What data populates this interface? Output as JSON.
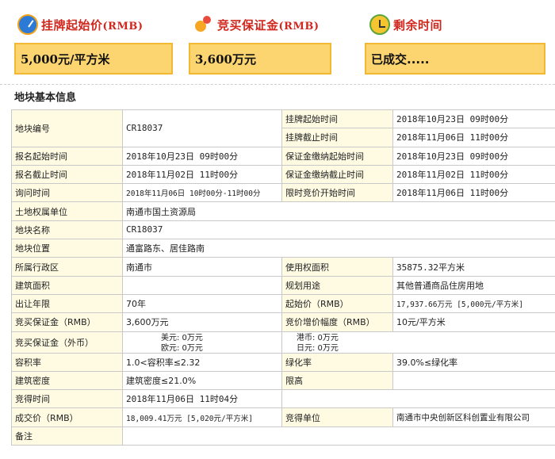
{
  "header": {
    "start_price_label": "挂牌起始价",
    "start_price_unit": "(RMB)",
    "deposit_label": "竞买保证金",
    "deposit_unit": "(RMB)",
    "remaining_label": "剩余时间",
    "start_price_value": "5,000元/平方米",
    "deposit_value": "3,600万元",
    "remaining_value": "已成交....."
  },
  "section_title": "地块基本信息",
  "icons": {
    "start_price": "gauge-icon",
    "deposit": "coins-hand-icon",
    "remaining": "alarm-clock-icon"
  },
  "table": {
    "r1": {
      "l1": "地块编号",
      "v1": "CR18037",
      "l2a": "挂牌起始时间",
      "v2a": "2018年10月23日 09时00分",
      "l2b": "挂牌截止时间",
      "v2b": "2018年11月06日 11时00分"
    },
    "r2": {
      "l1": "报名起始时间",
      "v1": "2018年10月23日 09时00分",
      "l2": "保证金缴纳起始时间",
      "v2": "2018年10月23日 09时00分"
    },
    "r3": {
      "l1": "报名截止时间",
      "v1": "2018年11月02日 11时00分",
      "l2": "保证金缴纳截止时间",
      "v2": "2018年11月02日 11时00分"
    },
    "r4": {
      "l1": "询问时间",
      "v1": "2018年11月06日 10时00分-11时00分",
      "l2": "限时竞价开始时间",
      "v2": "2018年11月06日 11时00分"
    },
    "r5": {
      "l1": "土地权属单位",
      "v1": "南通市国土资源局"
    },
    "r6": {
      "l1": "地块名称",
      "v1": "CR18037"
    },
    "r7": {
      "l1": "地块位置",
      "v1": "通富路东、居佳路南"
    },
    "r8": {
      "l1": "所属行政区",
      "v1": "南通市",
      "l2": "使用权面积",
      "v2": "35875.32平方米"
    },
    "r9": {
      "l1": "建筑面积",
      "v1": "",
      "l2": "规划用途",
      "v2": "其他普通商品住房用地"
    },
    "r10": {
      "l1": "出让年限",
      "v1": "70年",
      "l2": "起始价（RMB）",
      "v2": "17,937.66万元 [5,000元/平方米]"
    },
    "r11": {
      "l1": "竞买保证金（RMB）",
      "v1": "3,600万元",
      "l2": "竞价增价幅度（RMB）",
      "v2": "10元/平方米"
    },
    "r12": {
      "l1": "竞买保证金（外币）",
      "usd": "美元: 0万元",
      "eur": "欧元: 0万元",
      "hkd": "港币: 0万元",
      "jpy": "日元: 0万元"
    },
    "r13": {
      "l1": "容积率",
      "v1": "1.0<容积率≤2.32",
      "l2": "绿化率",
      "v2": "39.0%≤绿化率"
    },
    "r14": {
      "l1": "建筑密度",
      "v1": "建筑密度≤21.0%",
      "l2": "限高",
      "v2": ""
    },
    "r15": {
      "l1": "竞得时间",
      "v1": "2018年11月06日 11时04分"
    },
    "r16": {
      "l1": "成交价（RMB）",
      "v1": "18,009.41万元 [5,020元/平方米]",
      "l2": "竞得单位",
      "v2": "南通市中央创新区科创置业有限公司"
    },
    "r17": {
      "l1": "备注",
      "v1": ""
    }
  }
}
